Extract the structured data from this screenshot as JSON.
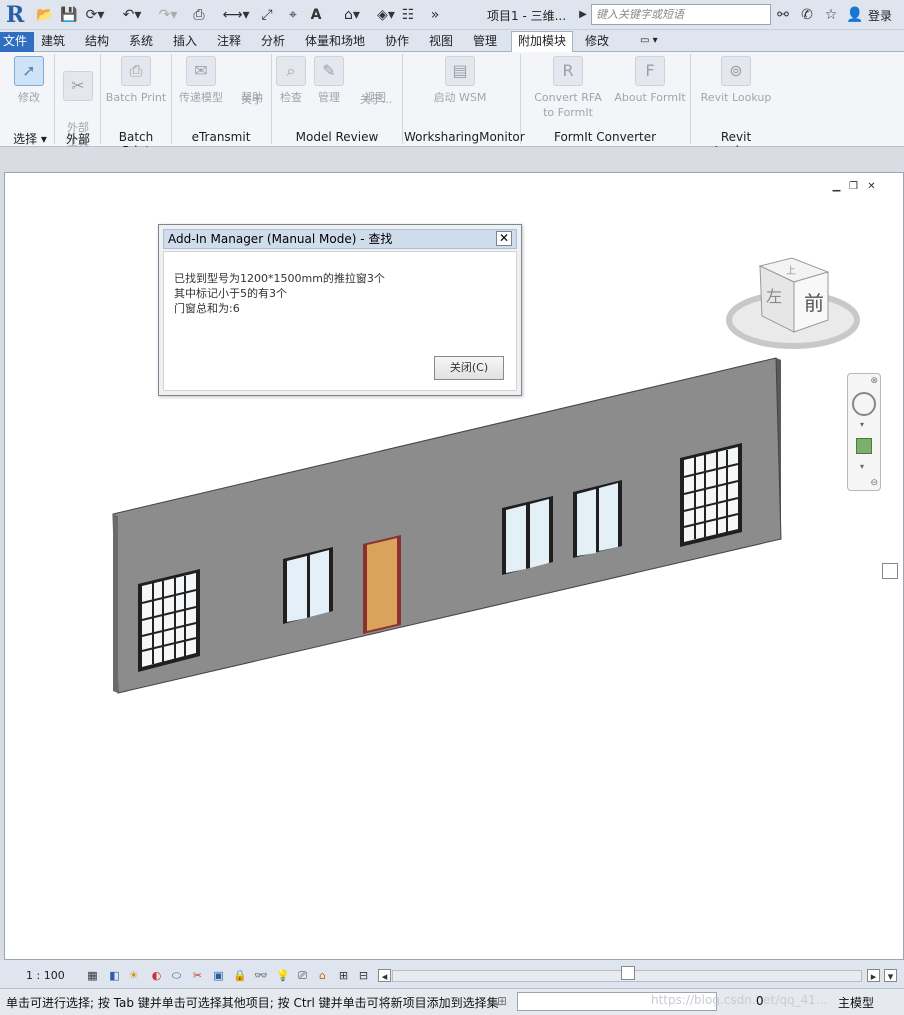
{
  "qat": {
    "title": "项目1 - 三维...",
    "search_placeholder": "键入关键字或短语",
    "login": "登录"
  },
  "tabs": [
    "文件",
    "建筑",
    "结构",
    "系统",
    "插入",
    "注释",
    "分析",
    "体量和场地",
    "协作",
    "视图",
    "管理",
    "附加模块",
    "修改"
  ],
  "active_tab": "附加模块",
  "ribbon": {
    "buttons": {
      "modify": "修改",
      "external_tools": "外部\n工具",
      "batch_print": "Batch Print",
      "transmit": "传递模型",
      "help": "帮助",
      "about": "关于",
      "check": "检查",
      "manage": "管理",
      "view": "视图",
      "about2": "关于...",
      "start_wsm": "启动 WSM",
      "convert_rfa_1": "Convert RFA",
      "convert_rfa_2": "to FormIt",
      "about_formit": "About FormIt",
      "revit_lookup": "Revit Lookup"
    },
    "panels": {
      "select": "选择",
      "external": "外部",
      "batch_print": "Batch Print",
      "etransmit": "eTransmit",
      "model_review": "Model Review",
      "wsm": "WorksharingMonitor",
      "formit": "FormIt Converter",
      "lookup": "Revit Lookup"
    }
  },
  "dialog": {
    "title": "Add-In Manager (Manual Mode) - 查找",
    "lines": [
      "已找到型号为1200*1500mm的推拉窗3个",
      "其中标记小于5的有3个",
      "门窗总和为:6"
    ],
    "close_button": "关闭(C)"
  },
  "viewcube": {
    "face_front": "前",
    "face_left": "左",
    "face_top": "上"
  },
  "viewbar": {
    "scale": "1 : 100"
  },
  "statusbar": {
    "message": "单击可进行选择; 按 Tab 键并单击可选择其他项目; 按 Ctrl 键并单击可将新项目添加到选择集",
    "model": "主模型",
    "zero": "0",
    "watermark": "https://blog.csdn.net/qq_41..."
  },
  "colors": {
    "wall_front": "#8c8c8c",
    "wall_top": "#5f5f5f",
    "door": "#d9a35c",
    "door_frame": "#8b2f2f",
    "glass": "#e4f0f7"
  }
}
